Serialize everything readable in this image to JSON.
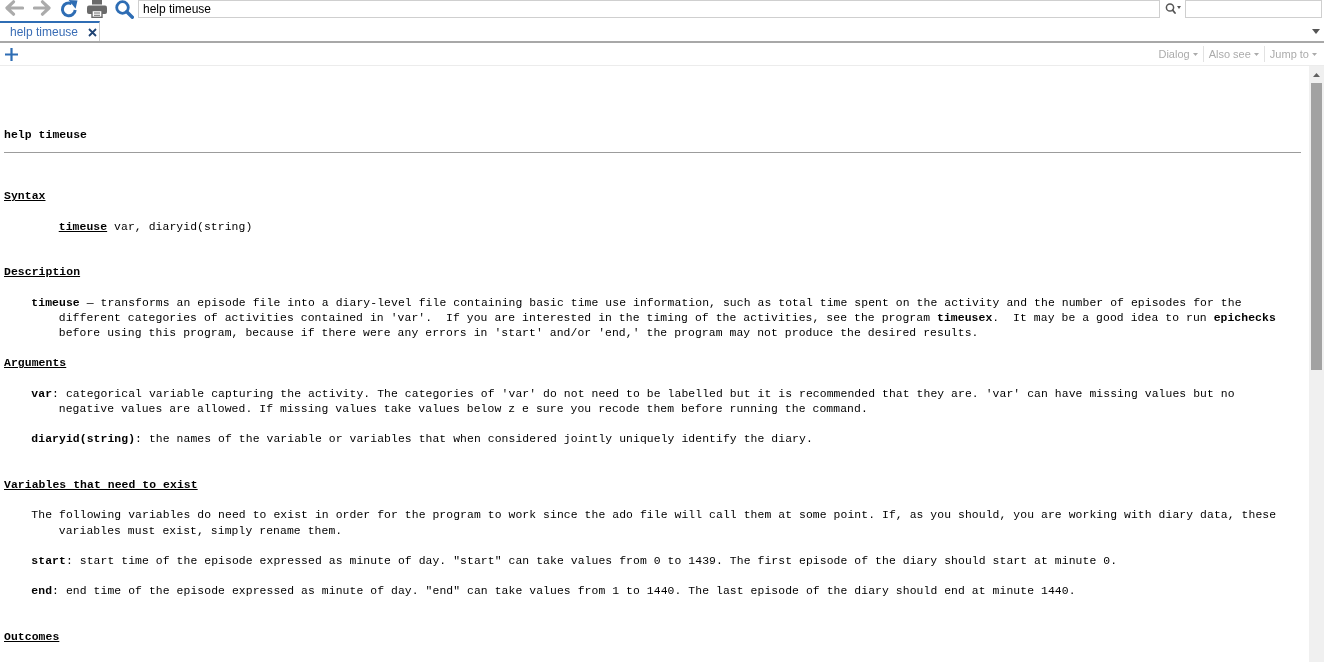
{
  "toolbar": {
    "buttons": [
      {
        "kind": "back",
        "disabled": true
      },
      {
        "kind": "forward",
        "disabled": true
      },
      {
        "kind": "refresh",
        "disabled": false
      },
      {
        "kind": "print",
        "disabled": false
      },
      {
        "kind": "find",
        "disabled": false
      }
    ],
    "address": "help timeuse"
  },
  "tabs": [
    {
      "label": "help timeuse",
      "selected": true
    }
  ],
  "menus": [
    {
      "label": "Dialog",
      "disabled": true
    },
    {
      "label": "Also see",
      "disabled": true
    },
    {
      "label": "Jump to",
      "disabled": true
    }
  ],
  "document": {
    "title": "help timeuse",
    "sections": [
      {
        "heading": "Syntax",
        "blocks": [
          {
            "kind": "syntax",
            "text": "**timeuse** var, diaryid(string)"
          }
        ]
      },
      {
        "heading": "Description",
        "blocks": [
          {
            "kind": "paragraph",
            "text": "**timeuse** — transforms an episode file into a diary-level file containing basic time use information, such as total time spent on the activity and the number of episodes for the different categories of activities contained in 'var'.  If you are interested in the timing of the activities, see the program **timeusex**.  It may be a good idea to run **epichecks** before using this program, because if there were any errors in 'start' and/or 'end,' the program may not produce the desired results."
          }
        ]
      },
      {
        "heading": "Arguments",
        "blocks": [
          {
            "kind": "paragraph",
            "text": "**var**: categorical variable capturing the activity. The categories of 'var' do not need to be labelled but it is recommended that they are. 'var' can have missing values but no negative values are allowed. If missing values take values below z e sure you recode them before running the command."
          },
          {
            "kind": "paragraph",
            "text": "**diaryid(string)**: the names of the variable or variables that when considered jointly uniquely identify the diary."
          }
        ]
      },
      {
        "heading": "Variables that need to exist",
        "blocks": [
          {
            "kind": "paragraph",
            "text": "The following variables do need to exist in order for the program to work since the ado file will call them at some point. If, as you should, you are working with diary data, these variables must exist, simply rename them."
          },
          {
            "kind": "paragraph",
            "text": "**start**: start time of the episode expressed as minute of day. \"start\" can take values from 0 to 1439. The first episode of the diary should start at minute 0."
          },
          {
            "kind": "paragraph",
            "text": "**end**: end time of the episode expressed as minute of day. \"end\" can take values from 1 to 1440. The last episode of the diary should end at minute 1440."
          }
        ]
      },
      {
        "heading": "Outcomes"
      }
    ]
  }
}
